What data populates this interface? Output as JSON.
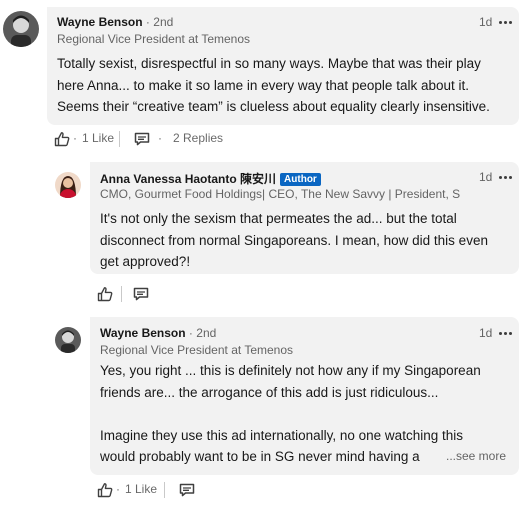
{
  "comment1": {
    "author": "Wayne Benson",
    "degree": "2nd",
    "headline": "Regional Vice President at Temenos",
    "time": "1d",
    "body": [
      "Totally sexist, disrespectful in so many ways. Maybe that was their play",
      "here Anna... to make it so lame in every way that people talk about it.",
      "Seems their “creative team” is clueless about equality clearly insensitive."
    ],
    "likes": "1 Like",
    "replies": "2 Replies"
  },
  "reply1": {
    "author": "Anna Vanessa Haotanto 陳安川",
    "badge": "Author",
    "headline": "CMO, Gourmet Food Holdings| CEO, The New Savvy | President, S...",
    "time": "1d",
    "body": [
      "It's not only the sexism that permeates the ad... but the total",
      "disconnect from normal Singaporeans. I mean, how did this even",
      "get approved?!"
    ]
  },
  "reply2": {
    "author": "Wayne Benson",
    "degree": "2nd",
    "headline": "Regional Vice President at Temenos",
    "time": "1d",
    "body": [
      "Yes, you right ... this is definitely not how any if my Singaporean",
      "friends are... the arrogance of this add is just ridiculous...",
      "",
      "Imagine they use this ad internationally, no one watching this",
      "would probably want to be in SG never mind having a"
    ],
    "see_more": "...see more",
    "likes": "1 Like"
  },
  "separator_dot": "·",
  "icons": {
    "like": "thumbs-up-icon",
    "reply": "comment-icon",
    "more": "ellipsis-icon"
  },
  "colors": {
    "bubble": "#f2f2f2",
    "accent": "#0a66c2"
  }
}
